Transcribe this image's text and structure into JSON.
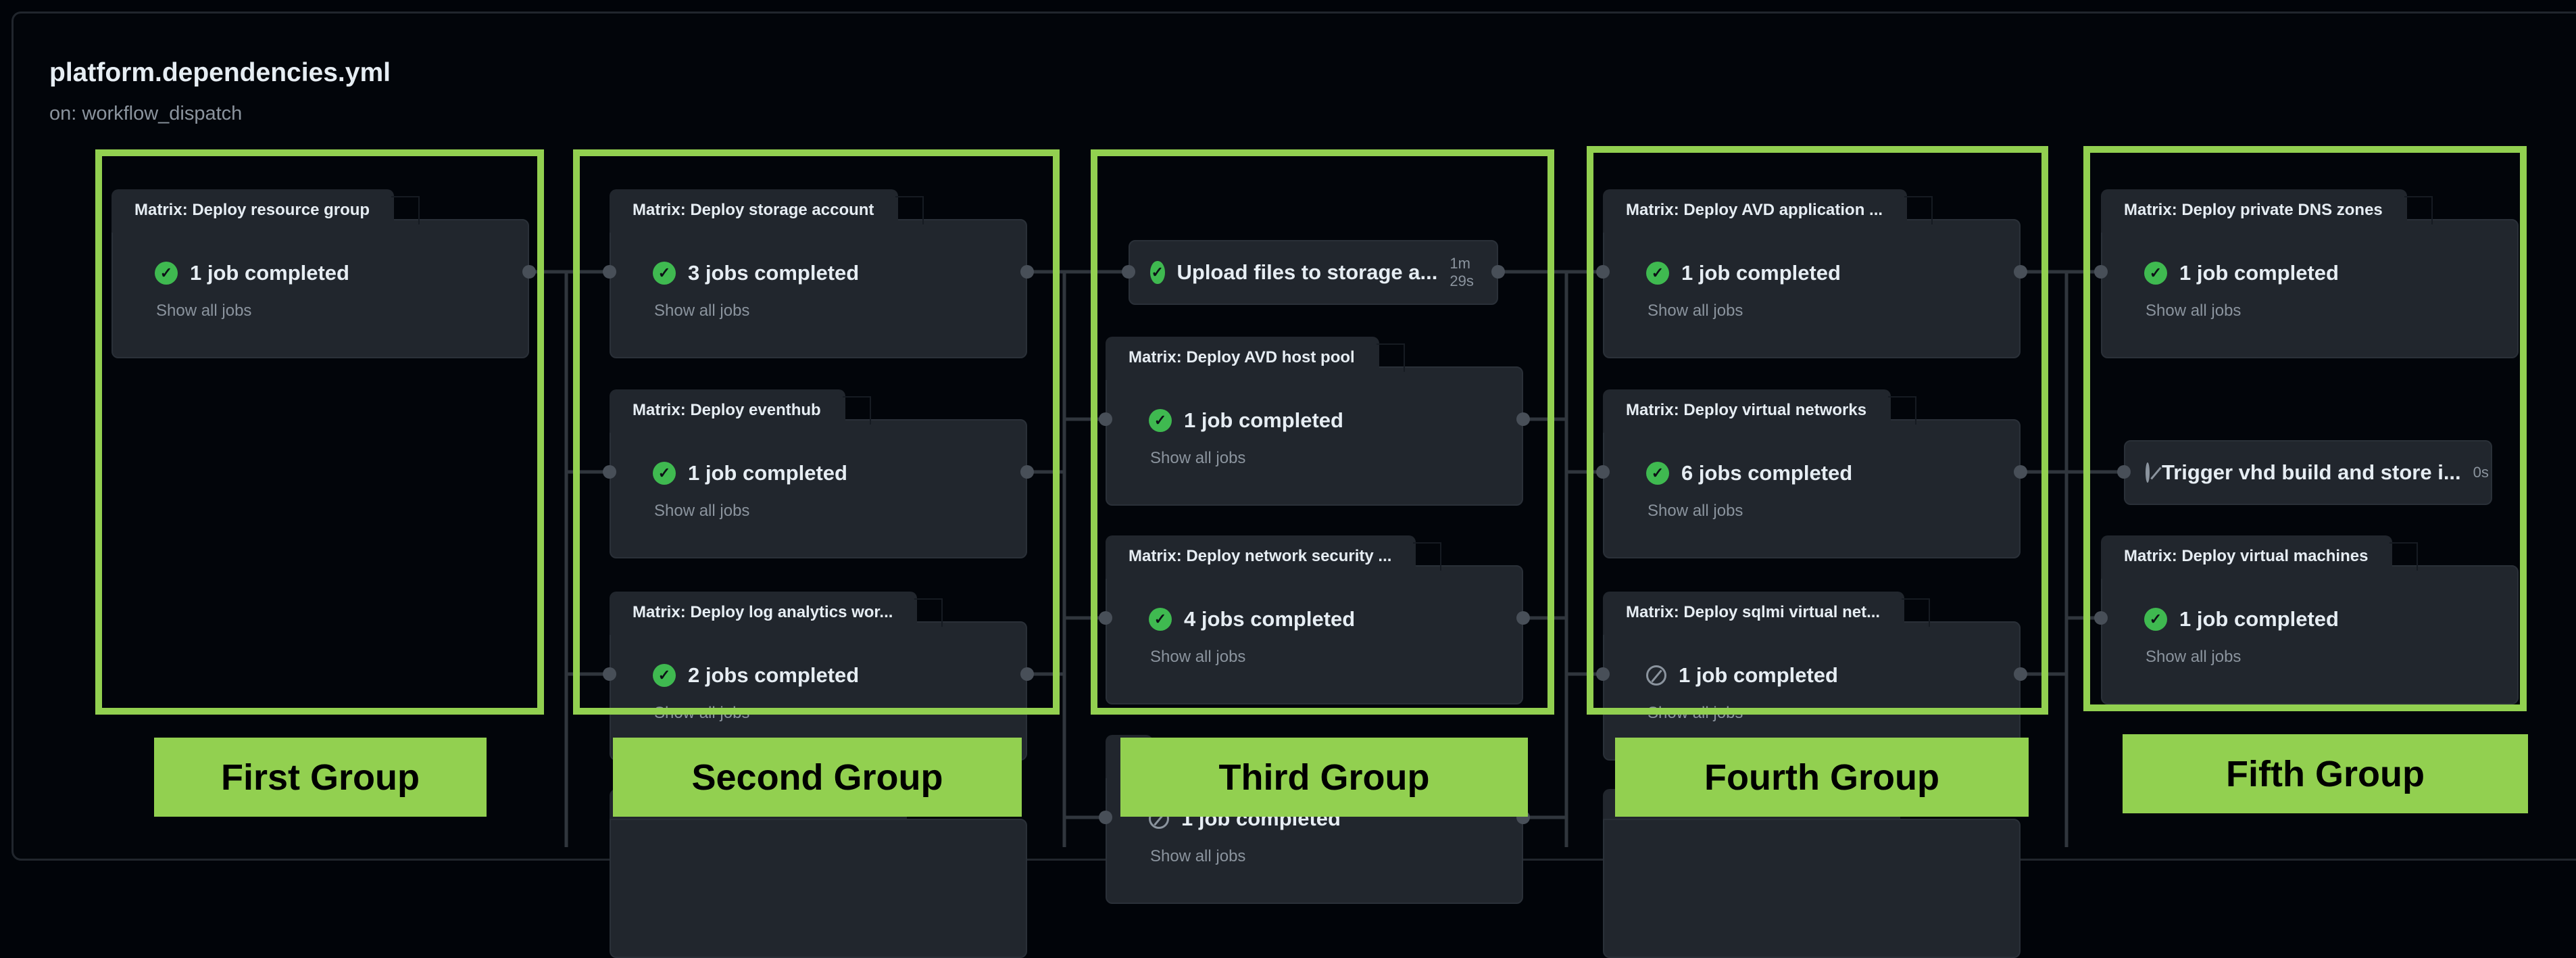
{
  "workflow": {
    "title": "platform.dependencies.yml",
    "trigger": "on: workflow_dispatch"
  },
  "show_all_label": "Show all jobs",
  "columns": [
    {
      "cards": [
        {
          "kind": "matrix",
          "title": "Matrix: Deploy resource group",
          "status": "1 job completed",
          "state": "success"
        }
      ]
    },
    {
      "cards": [
        {
          "kind": "matrix",
          "title": "Matrix: Deploy storage account",
          "status": "3 jobs completed",
          "state": "success"
        },
        {
          "kind": "matrix",
          "title": "Matrix: Deploy eventhub",
          "status": "1 job completed",
          "state": "success"
        },
        {
          "kind": "matrix",
          "title": "Matrix: Deploy log analytics wor...",
          "status": "2 jobs completed",
          "state": "success"
        }
      ]
    },
    {
      "cards": [
        {
          "kind": "job",
          "title": "Upload files to storage a...",
          "duration": "1m 29s",
          "state": "success"
        },
        {
          "kind": "matrix",
          "title": "Matrix: Deploy AVD host pool",
          "status": "1 job completed",
          "state": "success"
        },
        {
          "kind": "matrix",
          "title": "Matrix: Deploy network security ...",
          "status": "4 jobs completed",
          "state": "success"
        },
        {
          "kind": "matrix",
          "title": "",
          "status": "1 job completed",
          "state": "skipped"
        }
      ]
    },
    {
      "cards": [
        {
          "kind": "matrix",
          "title": "Matrix: Deploy AVD application ...",
          "status": "1 job completed",
          "state": "success"
        },
        {
          "kind": "matrix",
          "title": "Matrix: Deploy virtual networks",
          "status": "6 jobs completed",
          "state": "success"
        },
        {
          "kind": "matrix",
          "title": "Matrix: Deploy sqlmi virtual net...",
          "status": "1 job completed",
          "state": "skipped"
        }
      ]
    },
    {
      "cards": [
        {
          "kind": "matrix",
          "title": "Matrix: Deploy private DNS zones",
          "status": "1 job completed",
          "state": "success"
        },
        {
          "kind": "job",
          "title": "Trigger vhd build and store i...",
          "duration": "0s",
          "state": "skipped"
        },
        {
          "kind": "matrix",
          "title": "Matrix: Deploy virtual machines",
          "status": "1 job completed",
          "state": "success"
        }
      ]
    }
  ],
  "groups": [
    "First Group",
    "Second Group",
    "Third Group",
    "Fourth Group",
    "Fifth Group"
  ],
  "colors": {
    "highlight": "#92d050",
    "success": "#3fb950",
    "card": "#21262d",
    "background": "#010409"
  }
}
